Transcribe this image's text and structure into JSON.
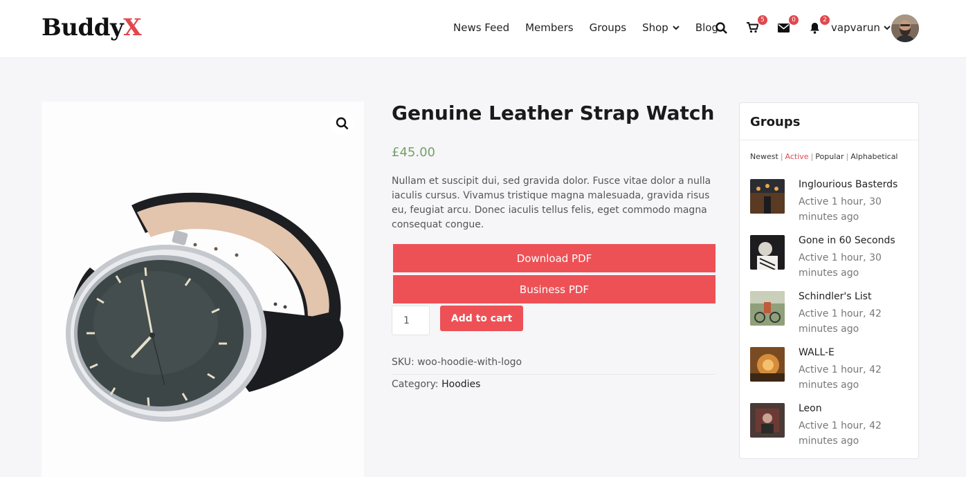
{
  "header": {
    "logo_main": "Buddy",
    "logo_accent": "X",
    "nav": [
      "News Feed",
      "Members",
      "Groups",
      "Shop",
      "Blog"
    ],
    "cart_count": "5",
    "messages_count": "0",
    "notifications_count": "2",
    "username": "vapvarun",
    "accent_color": "#e0484e"
  },
  "product": {
    "title": "Genuine Leather Strap Watch",
    "price": "£45.00",
    "description": "Nullam et suscipit dui, sed gravida dolor. Fusce vitae dolor a nulla iaculis cursus. Vivamus tristique magna malesuada, gravida risus eu, feugiat arcu. Donec iaculis tellus felis, eget commodo magna consequat congue.",
    "download_pdf": "Download PDF",
    "business_pdf": "Business PDF",
    "quantity": "1",
    "add_to_cart": "Add to cart",
    "sku_label": "SKU:",
    "sku_value": "woo-hoodie-with-logo",
    "category_label": "Category:",
    "category_value": "Hoodies",
    "button_color": "#ed5156",
    "price_color": "#73a167"
  },
  "groups_widget": {
    "title": "Groups",
    "filters": [
      "Newest",
      "Active",
      "Popular",
      "Alphabetical"
    ],
    "active_filter": "Active",
    "items": [
      {
        "name": "Inglourious Basterds",
        "time": "Active 1 hour, 30 minutes ago"
      },
      {
        "name": "Gone in 60 Seconds",
        "time": "Active 1 hour, 30 minutes ago"
      },
      {
        "name": "Schindler's List",
        "time": "Active 1 hour, 42 minutes ago"
      },
      {
        "name": "WALL-E",
        "time": "Active 1 hour, 42 minutes ago"
      },
      {
        "name": "Leon",
        "time": "Active 1 hour, 42 minutes ago"
      }
    ]
  },
  "icons": [
    "search-icon",
    "cart-icon",
    "envelope-icon",
    "bell-icon",
    "chevron-down-icon",
    "zoom-icon"
  ]
}
